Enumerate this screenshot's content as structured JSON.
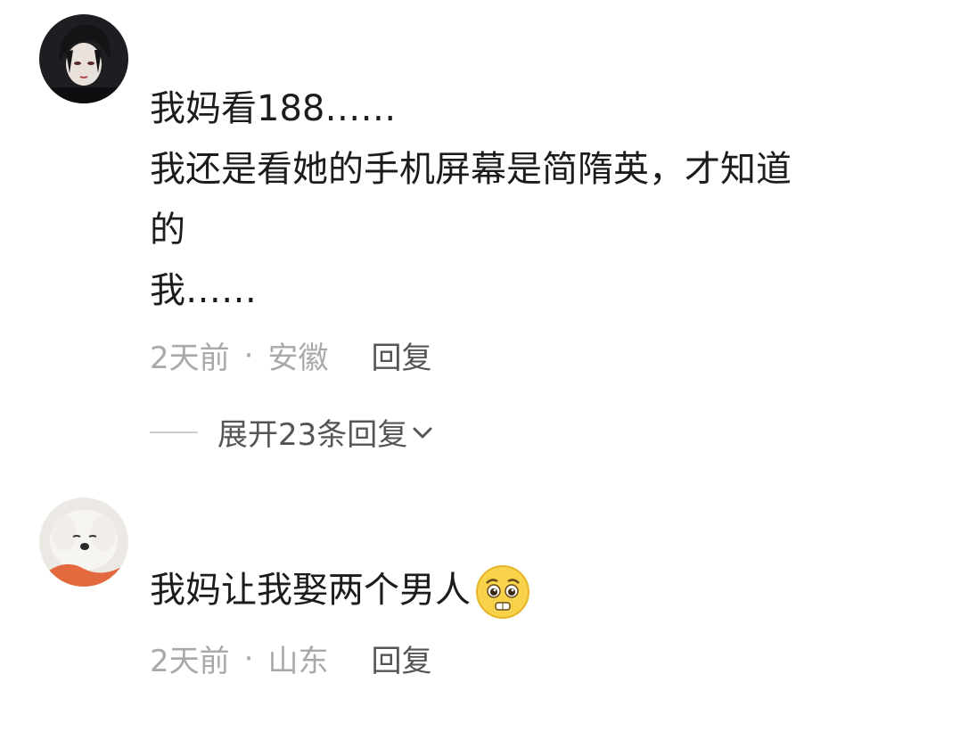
{
  "comments": [
    {
      "lines": [
        "我妈看188……",
        "我还是看她的手机屏幕是简隋英，才知道",
        "的",
        "我……"
      ],
      "time": "2天前",
      "separator": "·",
      "location": "安徽",
      "reply_label": "回复",
      "expand_label": "展开23条回复",
      "avatar_icon": "dark-haired-anime-avatar-icon"
    },
    {
      "lines": [
        "我妈让我娶两个男人"
      ],
      "time": "2天前",
      "separator": "·",
      "location": "山东",
      "reply_label": "回复",
      "avatar_icon": "white-dog-avatar-icon",
      "emoji_icon": "pleading-face-emoji-icon"
    }
  ]
}
